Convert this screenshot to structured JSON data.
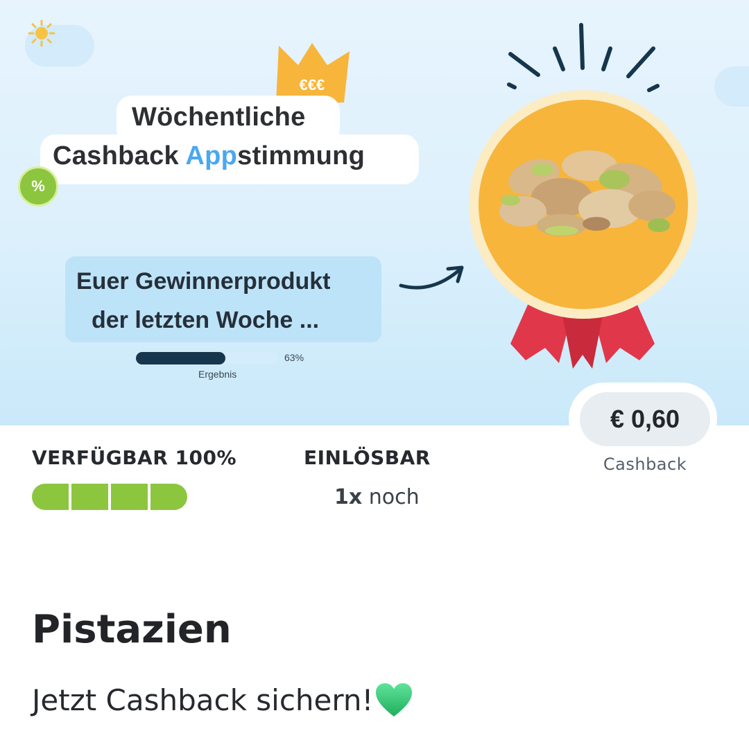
{
  "banner": {
    "title_line1": "Wöchentliche",
    "title_line2_prefix": "Cashback ",
    "title_line2_highlight": "App",
    "title_line2_suffix": "stimmung",
    "crown_text": "€€€",
    "percent_badge": "%",
    "winner_line1": "Euer Gewinnerprodukt",
    "winner_line2": "der letzten Woche ...",
    "result_percent_label": "63%",
    "result_percent_value": 63,
    "result_label": "Ergebnis"
  },
  "cashback": {
    "price": "€ 0,60",
    "label": "Cashback"
  },
  "availability": {
    "title": "VERFÜGBAR 100%",
    "level_percent": 100,
    "segments": 4
  },
  "redeem": {
    "title": "EINLÖSBAR",
    "count": "1x",
    "suffix": " noch"
  },
  "product": {
    "name": "Pistazien",
    "subtitle": "Jetzt Cashback sichern!"
  },
  "colors": {
    "accent_green": "#8cc63f",
    "app_blue": "#4aa8ef",
    "medal_gold": "#f7b53c",
    "ribbon_red": "#e0384a",
    "heart_green": "#2ecc71"
  }
}
